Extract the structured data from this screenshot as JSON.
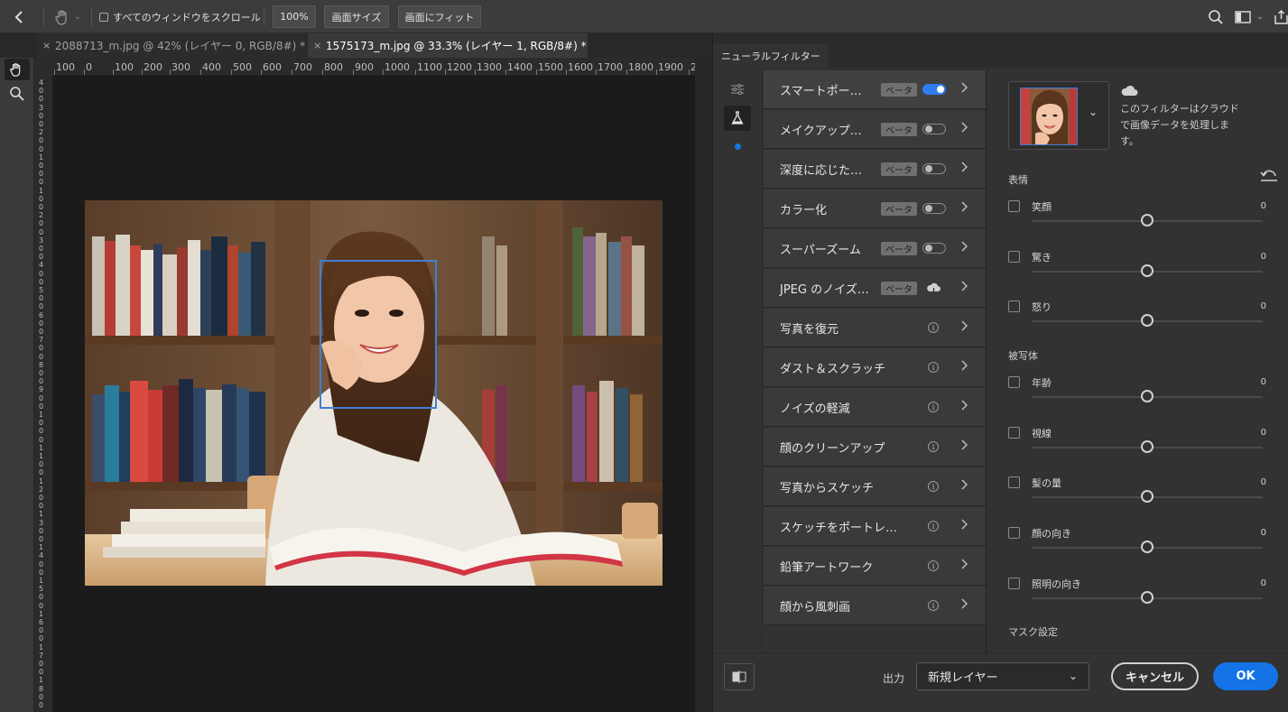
{
  "topbar": {
    "scroll_all_windows": "すべてのウィンドウをスクロール",
    "zoom_100": "100%",
    "fit_screen_size": "画面サイズ",
    "fit_to_screen": "画面にフィット"
  },
  "tabs": [
    {
      "label": "2088713_m.jpg @ 42% (レイヤー 0, RGB/8#) *",
      "close": "×"
    },
    {
      "label": "1575173_m.jpg @ 33.3% (レイヤー 1, RGB/8#) *",
      "close": "×"
    }
  ],
  "ruler_h": [
    "100",
    "0",
    "100",
    "200",
    "300",
    "400",
    "500",
    "600",
    "700",
    "800",
    "900",
    "1000",
    "1100",
    "1200",
    "1300",
    "1400",
    "1500",
    "1600",
    "1700",
    "1800",
    "1900",
    "2"
  ],
  "ruler_v": [
    "4",
    "0",
    "0",
    "3",
    "0",
    "0",
    "2",
    "0",
    "0",
    "1",
    "0",
    "0",
    "0",
    "1",
    "0",
    "0",
    "2",
    "0",
    "0",
    "3",
    "0",
    "0",
    "4",
    "0",
    "0",
    "5",
    "0",
    "0",
    "6",
    "0",
    "0",
    "7",
    "0",
    "0",
    "8",
    "0",
    "0",
    "9",
    "0",
    "0",
    "1",
    "0",
    "0",
    "0",
    "1",
    "1",
    "0",
    "0",
    "1",
    "2",
    "0",
    "0",
    "1",
    "3",
    "0",
    "0",
    "1",
    "4",
    "0",
    "0",
    "1",
    "5",
    "0",
    "0",
    "1",
    "6",
    "0",
    "0",
    "1",
    "7",
    "0",
    "0",
    "1",
    "8",
    "0",
    "0"
  ],
  "panel": {
    "title": "ニューラルフィルター",
    "filters": [
      {
        "label": "スマートポー…",
        "badge": "ベータ",
        "control": "toggle-on"
      },
      {
        "label": "メイクアップ…",
        "badge": "ベータ",
        "control": "toggle-off"
      },
      {
        "label": "深度に応じた…",
        "badge": "ベータ",
        "control": "toggle-off"
      },
      {
        "label": "カラー化",
        "badge": "ベータ",
        "control": "toggle-off"
      },
      {
        "label": "スーパーズーム",
        "badge": "ベータ",
        "control": "toggle-off"
      },
      {
        "label": "JPEG のノイズ…",
        "badge": "ベータ",
        "control": "download"
      },
      {
        "label": "写真を復元",
        "badge": "",
        "control": "info"
      },
      {
        "label": "ダスト＆スクラッチ",
        "badge": "",
        "control": "info"
      },
      {
        "label": "ノイズの軽減",
        "badge": "",
        "control": "info"
      },
      {
        "label": "顔のクリーンアップ",
        "badge": "",
        "control": "info"
      },
      {
        "label": "写真からスケッチ",
        "badge": "",
        "control": "info"
      },
      {
        "label": "スケッチをポートレ…",
        "badge": "",
        "control": "info"
      },
      {
        "label": "鉛筆アートワーク",
        "badge": "",
        "control": "info"
      },
      {
        "label": "顔から風刺画",
        "badge": "",
        "control": "info"
      }
    ],
    "cloud_note": "このフィルターはクラウドで画像データを処理します。",
    "section_expression": "表情",
    "section_subject": "被写体",
    "section_mask": "マスク設定",
    "expression_sliders": [
      {
        "label": "笑顔",
        "value": "0"
      },
      {
        "label": "驚き",
        "value": "0"
      },
      {
        "label": "怒り",
        "value": "0"
      }
    ],
    "subject_sliders": [
      {
        "label": "年齢",
        "value": "0"
      },
      {
        "label": "視線",
        "value": "0"
      },
      {
        "label": "髪の量",
        "value": "0"
      },
      {
        "label": "顔の向き",
        "value": "0"
      },
      {
        "label": "照明の向き",
        "value": "0"
      }
    ],
    "output_label": "出力",
    "output_value": "新規レイヤー",
    "cancel": "キャンセル",
    "ok": "OK",
    "info_glyph": "i"
  },
  "colors": {
    "accent": "#1473e6",
    "face_box": "#3f7fd4",
    "toggle_on": "#2f7bf0"
  }
}
